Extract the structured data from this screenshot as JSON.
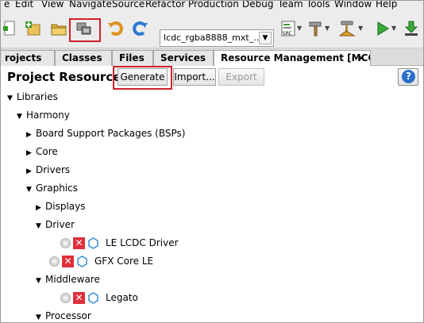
{
  "menu": [
    "e",
    "Edit",
    "View",
    "Navigate",
    "Source",
    "Refactor",
    "Production",
    "Debug",
    "Team",
    "Tools",
    "Window",
    "Help"
  ],
  "toolbar": {
    "config_value": "lcdc_rgba8888_mxt_..."
  },
  "tabs": [
    {
      "label": "rojects"
    },
    {
      "label": "Classes"
    },
    {
      "label": "Files"
    },
    {
      "label": "Services"
    },
    {
      "label": "Resource Management [MCC]",
      "close": "×"
    }
  ],
  "panel": {
    "title": "Project Resources",
    "generate_label": "Generate",
    "import_label": "Import...",
    "export_label": "Export",
    "help_label": "?"
  },
  "tree": {
    "libraries": "Libraries",
    "harmony": "Harmony",
    "bsps": "Board Support Packages (BSPs)",
    "core": "Core",
    "drivers": "Drivers",
    "graphics": "Graphics",
    "displays": "Displays",
    "driver": "Driver",
    "le_lcdc_driver": "LE LCDC Driver",
    "gfx_core_le": "GFX Core LE",
    "middleware": "Middleware",
    "legato": "Legato",
    "processor": "Processor"
  },
  "colors": {
    "highlight": "#d0202a",
    "error": "#e0303a",
    "component_hex": "#3a8fd8"
  }
}
